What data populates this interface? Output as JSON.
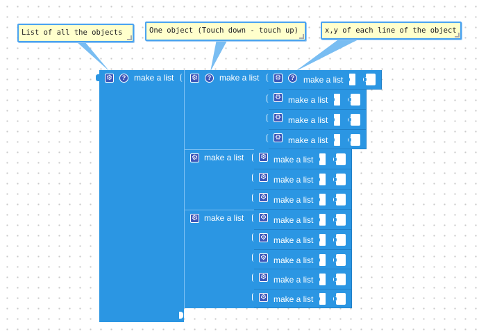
{
  "comments": [
    {
      "text": "List of all the objects"
    },
    {
      "text": "One object (Touch down - touch up)"
    },
    {
      "text": "x,y of each line of the object"
    }
  ],
  "blocks": {
    "label": "make a list",
    "gear_glyph": "⚙",
    "help_glyph": "?",
    "color": "#2b96e3",
    "icon_color": "#3d57b9"
  },
  "workspace": {
    "background": "#ffffff",
    "dot_color": "#c9c9c9",
    "comment_background": "#ffffcc",
    "comment_border": "#4aa3f0"
  }
}
